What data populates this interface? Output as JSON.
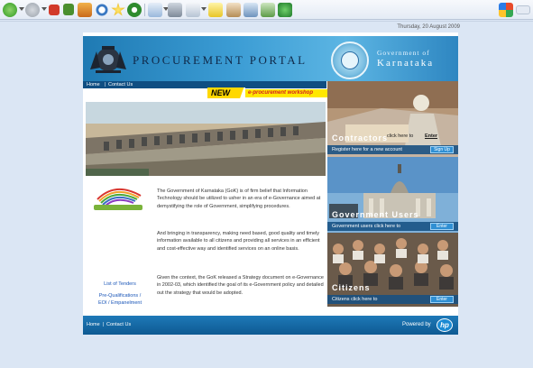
{
  "browser": {
    "toolbar_icons": [
      "back-icon",
      "forward-icon",
      "stop-icon",
      "refresh-icon",
      "home-icon",
      "search-icon",
      "favorites-icon",
      "history-icon",
      "mail-icon",
      "print-icon",
      "edit-icon",
      "discuss-icon",
      "research-icon",
      "messenger-icon",
      "translate-icon",
      "windows-flag-icon"
    ],
    "colors": {
      "toolbar": "#e9eff7",
      "page_bg": "#dbe6f4"
    }
  },
  "page": {
    "date": "Thursday, 20 August 2009"
  },
  "header": {
    "portal_title": "PROCUREMENT PORTAL",
    "gov_line1": "Government of",
    "gov_line2": "Karnataka",
    "colors": {
      "header": "#3b9cd4",
      "nav": "#0f4e82"
    }
  },
  "nav": {
    "home": "Home",
    "separator": "|",
    "contact": "Contact Us"
  },
  "banner": {
    "new_label": "NEW",
    "workshop_text": "e-procurement workshop"
  },
  "left_links": {
    "list_of_tenders": "List of Tenders",
    "prequal_line1": "Pre-Qualifications /",
    "prequal_line2": "EOI / Empanelment"
  },
  "content": {
    "paragraph1": "The Government of Karnataka (GoK) is of firm belief that Information Technology should be utilized to usher in an era of e-Governance aimed at demystifying the role of Government, simplifying procedures.",
    "paragraph2": "And bringing in transparency, making need based, good quality and timely information available to all citizens and providing all services in an efficient and cost-effective way and identified services on an online basis.",
    "paragraph3": "Given the context, the GoK released a Strategy document on e-Governance in 2002-03, which identified the goal of its e-Government policy and detailed out the strategy that would be adopted."
  },
  "panels": {
    "contractors": {
      "title": "Contractors",
      "click_text": "click here to",
      "enter_link": "Enter",
      "register_text": "Register here for a new account",
      "signup_button": "Sign Up"
    },
    "government_users": {
      "title": "Government Users",
      "bar_text": "Government users click here to",
      "enter_button": "Enter"
    },
    "citizens": {
      "title": "Citizens",
      "bar_text": "Citizens click here to",
      "enter_button": "Enter"
    }
  },
  "footer": {
    "home": "Home",
    "separator": "|",
    "contact": "Contact Us",
    "powered_by": "Powered by",
    "hp_logo_text": "hp"
  }
}
